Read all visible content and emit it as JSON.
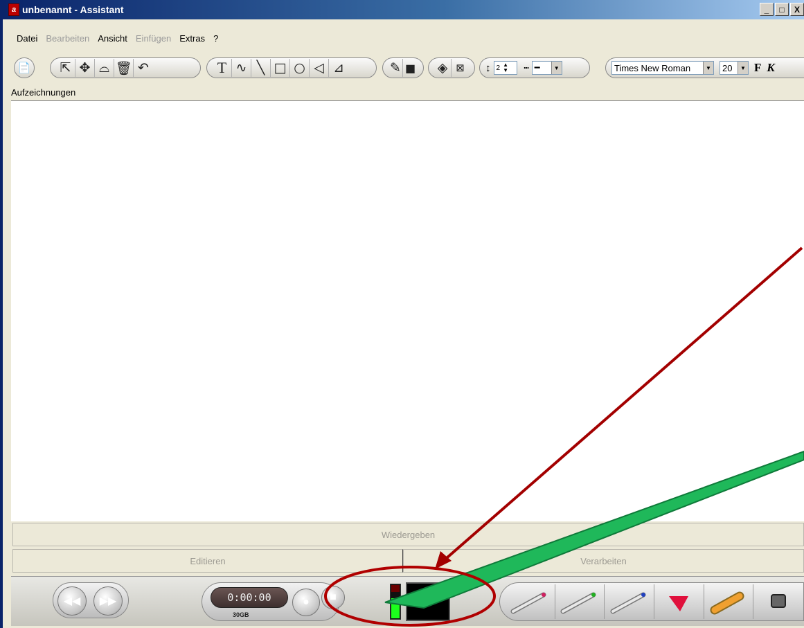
{
  "window": {
    "title": "unbenannt - Assistant",
    "icon_glyph": "a",
    "buttons": {
      "minimize": "_",
      "maximize": "□",
      "close": "X"
    }
  },
  "menu": {
    "items": [
      {
        "label": "Datei",
        "enabled": true
      },
      {
        "label": "Bearbeiten",
        "enabled": false
      },
      {
        "label": "Ansicht",
        "enabled": true
      },
      {
        "label": "Einfügen",
        "enabled": false
      },
      {
        "label": "Extras",
        "enabled": true
      },
      {
        "label": "?",
        "enabled": true
      }
    ]
  },
  "toolbar": {
    "line_width": "2",
    "font_name": "Times New Roman",
    "font_size": "20",
    "bold_label": "F",
    "italic_label": "K"
  },
  "section": {
    "label": "Aufzeichnungen"
  },
  "tabs": {
    "playback": "Wiedergeben",
    "edit": "Editieren",
    "process": "Verarbeiten"
  },
  "transport": {
    "time": "0:00:00",
    "disk_space": "30GB",
    "level_fraction": 0.6
  },
  "colors": {
    "title_start": "#0a246a",
    "title_end": "#a6caf0",
    "annotation_red": "#a30000",
    "annotation_green": "#1fb85a",
    "level_green": "#1cff1c"
  }
}
